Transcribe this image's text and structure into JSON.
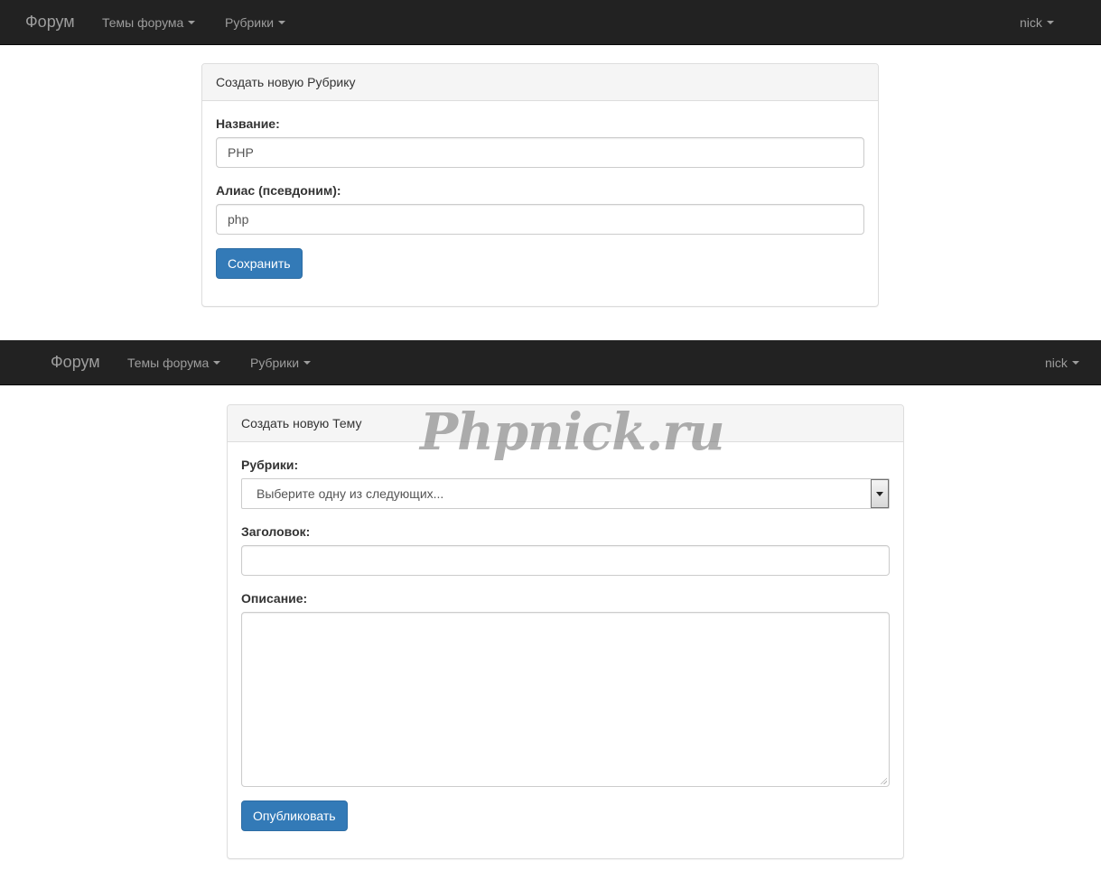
{
  "screen1": {
    "navbar": {
      "brand": "Форум",
      "topics_menu": "Темы форума",
      "rubrics_menu": "Рубрики",
      "user_menu": "nick"
    },
    "panel": {
      "heading": "Создать новую Рубрику",
      "name_label": "Название:",
      "name_value": "PHP",
      "alias_label": "Алиас (псевдоним):",
      "alias_value": "php",
      "save_button": "Сохранить"
    }
  },
  "screen2": {
    "navbar": {
      "brand": "Форум",
      "topics_menu": "Темы форума",
      "rubrics_menu": "Рубрики",
      "user_menu": "nick"
    },
    "panel": {
      "heading": "Создать новую Тему",
      "rubric_label": "Рубрики:",
      "rubric_selected": "Выберите одну из следующих...",
      "title_label": "Заголовок:",
      "title_value": "",
      "description_label": "Описание:",
      "description_value": "",
      "publish_button": "Опубликовать"
    }
  },
  "watermark": "Phpnick.ru",
  "colors": {
    "navbar_bg": "#222222",
    "navbar_text": "#9d9d9d",
    "primary_button": "#337ab7",
    "panel_heading_bg": "#f5f5f5",
    "panel_border": "#dddddd"
  }
}
